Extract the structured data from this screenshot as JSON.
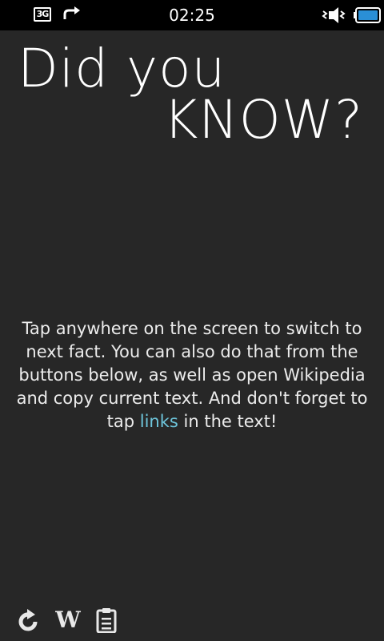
{
  "status_bar": {
    "network_label": "3G",
    "time": "02:25"
  },
  "title": {
    "line1": "Did you",
    "line2": "KNOW?"
  },
  "fact": {
    "text_before_link": "Tap anywhere on the screen to switch to next fact. You can also do that from the buttons below, as well as open Wikipedia and copy current text. And don't forget to tap ",
    "link_text": "links",
    "text_after_link": " in the text!"
  },
  "toolbar": {
    "wiki_label": "W",
    "icons": [
      "refresh-icon",
      "wikipedia-icon",
      "clipboard-icon"
    ]
  },
  "colors": {
    "background": "#272727",
    "link": "#6ec6dc",
    "battery": "#2a8fd6"
  }
}
